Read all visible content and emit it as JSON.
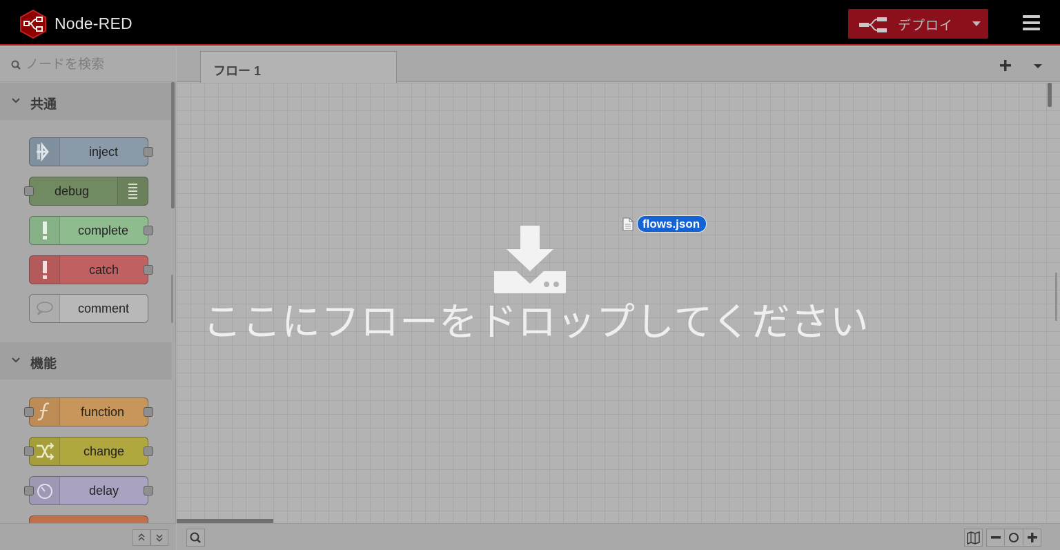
{
  "header": {
    "app_title": "Node-RED",
    "deploy_label": "デプロイ",
    "colors": {
      "background": "#000000",
      "accent": "#b51a1a",
      "deploy_button": "#8c101c"
    }
  },
  "palette": {
    "search_placeholder": "ノードを検索",
    "categories": [
      {
        "label": "共通",
        "nodes": [
          {
            "label": "inject",
            "color": "#8a9aa8",
            "icon": "arrow-in-icon"
          },
          {
            "label": "debug",
            "color": "#728a62",
            "icon": "list-icon"
          },
          {
            "label": "complete",
            "color": "#8fbc8f",
            "icon": "exclamation-icon"
          },
          {
            "label": "catch",
            "color": "#c06060",
            "icon": "exclamation-icon"
          },
          {
            "label": "comment",
            "color": "#b8b8b8",
            "icon": "speech-bubble-icon"
          }
        ]
      },
      {
        "label": "機能",
        "nodes": [
          {
            "label": "function",
            "color": "#c8955a",
            "icon": "function-icon"
          },
          {
            "label": "change",
            "color": "#b0a83e",
            "icon": "shuffle-icon"
          },
          {
            "label": "delay",
            "color": "#a9a2c0",
            "icon": "timer-icon"
          }
        ]
      }
    ]
  },
  "workspace": {
    "tabs": [
      {
        "label": "フロー 1"
      }
    ],
    "drop_message": "ここにフローをドロップしてください",
    "dragged_file": "flows.json"
  }
}
